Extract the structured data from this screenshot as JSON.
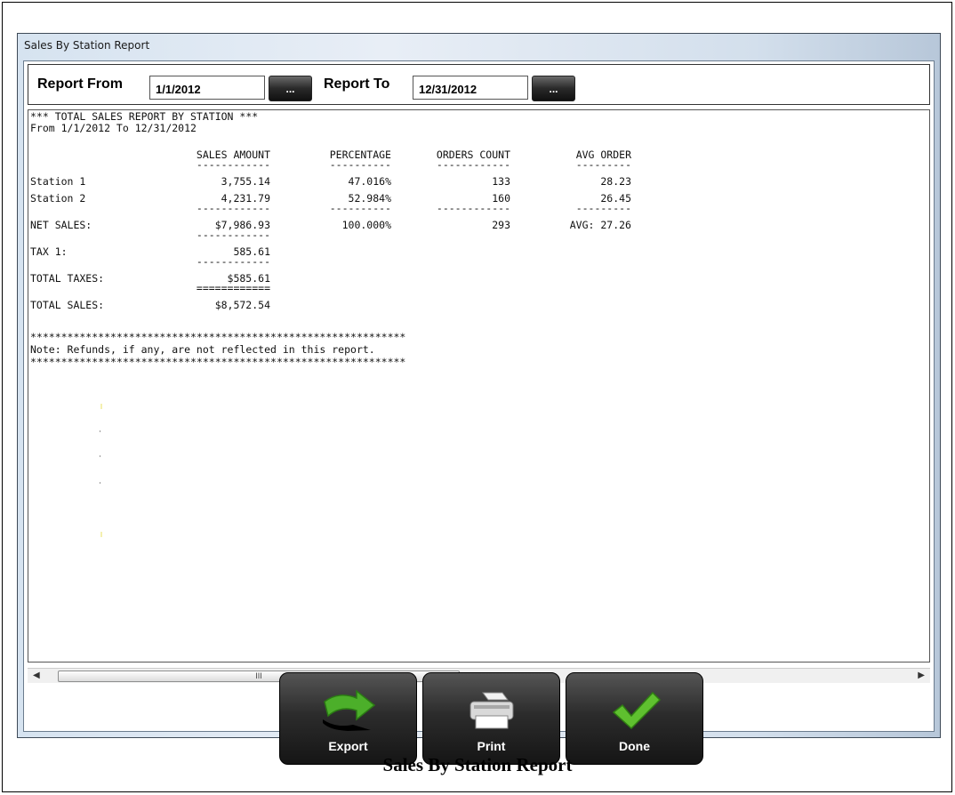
{
  "window": {
    "title": "Sales By Station Report"
  },
  "date_filter": {
    "from_label": "Report From",
    "from_value": "1/1/2012",
    "to_label": "Report To",
    "to_value": "12/31/2012",
    "picker_label": "..."
  },
  "report": {
    "header": "*** TOTAL SALES REPORT BY STATION ***",
    "range": "From 1/1/2012 To 12/31/2012",
    "columns": [
      "SALES AMOUNT",
      "PERCENTAGE",
      "ORDERS COUNT",
      "AVG ORDER"
    ],
    "rows": [
      {
        "name": "Station 1",
        "sales": "3,755.14",
        "pct": "47.016%",
        "orders": "133",
        "avg": "28.23"
      },
      {
        "name": "Station 2",
        "sales": "4,231.79",
        "pct": "52.984%",
        "orders": "160",
        "avg": "26.45"
      }
    ],
    "net": {
      "name": "NET SALES:",
      "sales": "$7,986.93",
      "pct": "100.000%",
      "orders": "293",
      "avg": "AVG: 27.26"
    },
    "tax1": {
      "name": "TAX 1:",
      "value": "585.61"
    },
    "total_taxes": {
      "name": "TOTAL TAXES:",
      "value": "$585.61"
    },
    "total_sales": {
      "name": "TOTAL SALES:",
      "value": "$8,572.54"
    },
    "stars": "*************************************************************",
    "note": "Note: Refunds, if any, are not reflected in this report.",
    "dash12": "------------",
    "dash10": "----------",
    "dash9": "---------",
    "eq12": "============"
  },
  "scrollbar": {
    "left_arrow": "◀",
    "right_arrow": "▶",
    "thumb_grip": "III"
  },
  "buttons": {
    "export": "Export",
    "print": "Print",
    "done": "Done"
  },
  "caption": "Sales By Station Report"
}
